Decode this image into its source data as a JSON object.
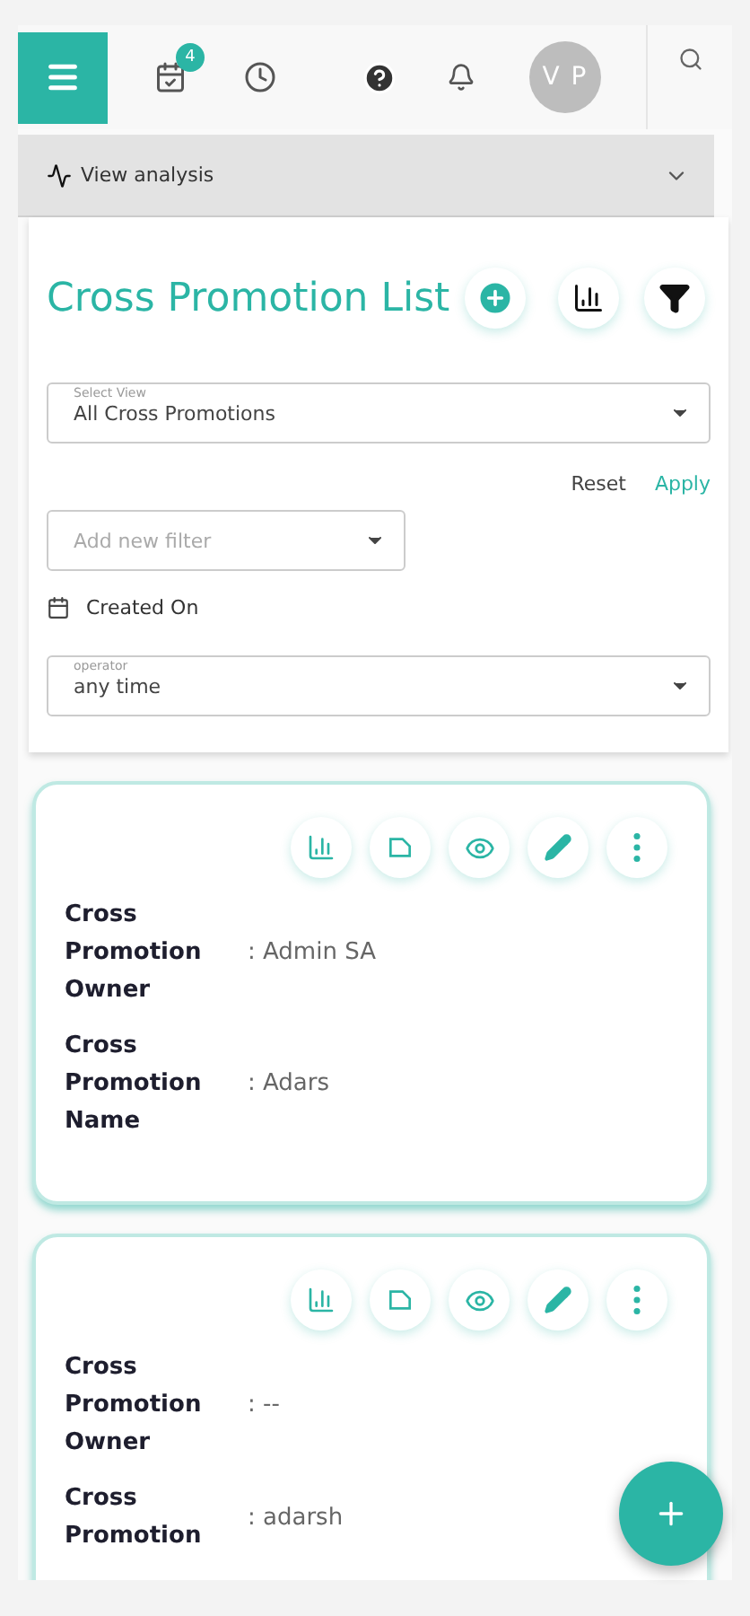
{
  "header": {
    "task_badge": "4",
    "avatar": "V P"
  },
  "analysis_bar": {
    "label": "View analysis",
    "expanded": false
  },
  "title": "Cross Promotion List",
  "filters": {
    "select_view": {
      "label": "Select View",
      "value": "All Cross Promotions"
    },
    "reset": "Reset",
    "apply": "Apply",
    "new_filter": {
      "placeholder": "Add new filter"
    },
    "date_filter": {
      "label": "Created On"
    },
    "operator": {
      "label": "operator",
      "value": "any time"
    }
  },
  "cards": [
    {
      "fields": [
        {
          "label": "Cross Promotion Owner",
          "value": ": Admin SA"
        },
        {
          "label": "Cross Promotion Name",
          "value": ": Adars"
        }
      ]
    },
    {
      "fields": [
        {
          "label": "Cross Promotion Owner",
          "value": ": --"
        },
        {
          "label": "Cross Promotion",
          "value": ": adarsh"
        }
      ]
    }
  ]
}
